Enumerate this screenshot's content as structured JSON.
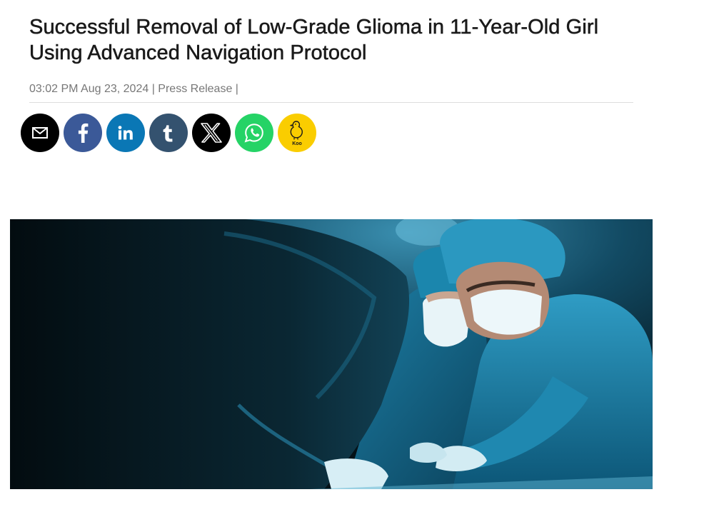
{
  "article": {
    "headline_line1": "Successful Removal of Low-Grade Glioma in 11-Year-Old Girl",
    "headline_line2": "Using Advanced Navigation Protocol",
    "time": "03:02 PM Aug 23, 2024",
    "separator1": " | ",
    "category": "Press Release",
    "separator2": " |"
  },
  "share": {
    "buttons": [
      {
        "name": "email",
        "icon": "mail-icon",
        "color": "#000000"
      },
      {
        "name": "facebook",
        "icon": "facebook-icon",
        "color": "#3b5998"
      },
      {
        "name": "linkedin",
        "icon": "linkedin-icon",
        "color": "#0a77b5"
      },
      {
        "name": "tumblr",
        "icon": "tumblr-icon",
        "color": "#34526f"
      },
      {
        "name": "x",
        "icon": "x-icon",
        "color": "#000000"
      },
      {
        "name": "whatsapp",
        "icon": "whatsapp-icon",
        "color": "#25d366"
      },
      {
        "name": "koo",
        "icon": "koo-icon",
        "label": "Koo",
        "color": "#facd00"
      }
    ]
  },
  "hero_image": {
    "subject": "surgeons-operating-photo",
    "palette": [
      "#061820",
      "#0e5f7e",
      "#2a9bc0",
      "#dff1f6"
    ]
  }
}
